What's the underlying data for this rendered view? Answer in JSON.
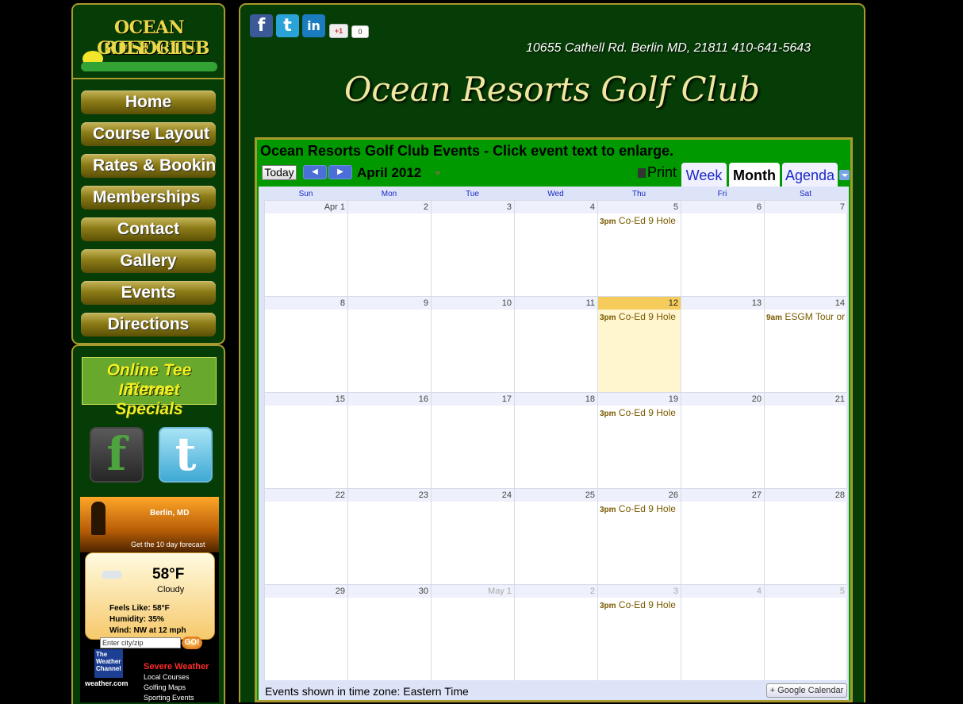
{
  "logo": {
    "line1": "OCEAN RESORTS",
    "line2": "GOLF CLUB"
  },
  "nav": [
    {
      "label": "Home"
    },
    {
      "label": "Course Layout"
    },
    {
      "label": "Rates & Booking"
    },
    {
      "label": "Memberships"
    },
    {
      "label": "Contact"
    },
    {
      "label": "Gallery"
    },
    {
      "label": "Events"
    },
    {
      "label": "Directions"
    }
  ],
  "promo": {
    "line1": "Online Tee Times",
    "line2": "Internet Specials"
  },
  "social_sidebar": {
    "facebook_glyph": "f",
    "twitter_glyph": "t"
  },
  "weather": {
    "city": "Berlin, MD",
    "forecast_link": "Get the 10 day forecast",
    "temp": "58°F",
    "condition": "Cloudy",
    "feels": "Feels Like: 58°F",
    "humidity": "Humidity: 35%",
    "wind": "Wind: NW at 12 mph",
    "input_placeholder": "Enter city/zip",
    "go": "GO!",
    "brand": "The Weather Channel",
    "brand_site": "weather.com",
    "links": [
      "Severe Weather",
      "Local Courses",
      "Golfing Maps",
      "Sporting Events"
    ]
  },
  "share": {
    "fb": "f",
    "tw": "t",
    "li": "in",
    "gplus": "+1",
    "gcount": "0"
  },
  "address": "10655 Cathell Rd. Berlin MD, 21811 410-641-5643",
  "site_title": "Ocean Resorts Golf Club",
  "calendar": {
    "heading": "Ocean Resorts Golf Club Events - Click event text to enlarge.",
    "today": "Today",
    "month_label": "April 2012",
    "print": "Print",
    "tabs": [
      "Week",
      "Month",
      "Agenda"
    ],
    "days": [
      "Sun",
      "Mon",
      "Tue",
      "Wed",
      "Thu",
      "Fri",
      "Sat"
    ],
    "weeks": [
      [
        {
          "d": "Apr 1"
        },
        {
          "d": "2"
        },
        {
          "d": "3"
        },
        {
          "d": "4"
        },
        {
          "d": "5",
          "t": "3pm",
          "e": "Co-Ed 9 Hole"
        },
        {
          "d": "6"
        },
        {
          "d": "7"
        }
      ],
      [
        {
          "d": "8"
        },
        {
          "d": "9"
        },
        {
          "d": "10"
        },
        {
          "d": "11"
        },
        {
          "d": "12",
          "t": "3pm",
          "e": "Co-Ed 9 Hole",
          "today": true
        },
        {
          "d": "13"
        },
        {
          "d": "14",
          "t": "9am",
          "e": "ESGM Tour or"
        }
      ],
      [
        {
          "d": "15"
        },
        {
          "d": "16"
        },
        {
          "d": "17"
        },
        {
          "d": "18"
        },
        {
          "d": "19",
          "t": "3pm",
          "e": "Co-Ed 9 Hole"
        },
        {
          "d": "20"
        },
        {
          "d": "21"
        }
      ],
      [
        {
          "d": "22"
        },
        {
          "d": "23"
        },
        {
          "d": "24"
        },
        {
          "d": "25"
        },
        {
          "d": "26",
          "t": "3pm",
          "e": "Co-Ed 9 Hole"
        },
        {
          "d": "27"
        },
        {
          "d": "28"
        }
      ],
      [
        {
          "d": "29"
        },
        {
          "d": "30"
        },
        {
          "d": "May 1",
          "other": true
        },
        {
          "d": "2",
          "other": true
        },
        {
          "d": "3",
          "t": "3pm",
          "e": "Co-Ed 9 Hole",
          "other": true
        },
        {
          "d": "4",
          "other": true
        },
        {
          "d": "5",
          "other": true
        }
      ]
    ],
    "timezone": "Events shown in time zone: Eastern Time",
    "gcal_badge": "Google Calendar"
  },
  "colors": {
    "accent": "#a89a2c",
    "panel": "#063d06",
    "calendar_header": "#009900"
  }
}
